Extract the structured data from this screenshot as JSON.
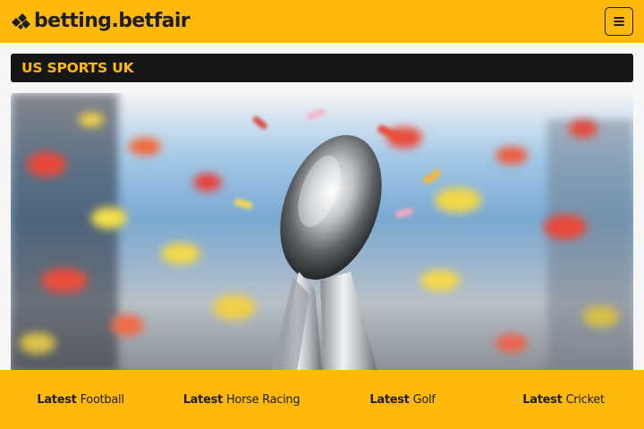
{
  "header": {
    "logo_text": "betting.betfair",
    "menu_icon": "hamburger-menu-icon",
    "brand_color": "#ffb80c",
    "text_color": "#1e1e1e"
  },
  "section": {
    "title": "US SPORTS UK",
    "background": "#161616",
    "title_color": "#ffb80c"
  },
  "hero": {
    "subject": "trophy-image"
  },
  "bottom_nav": {
    "items": [
      {
        "prefix": "Latest",
        "label": "Football"
      },
      {
        "prefix": "Latest",
        "label": "Horse Racing"
      },
      {
        "prefix": "Latest",
        "label": "Golf"
      },
      {
        "prefix": "Latest",
        "label": "Cricket"
      }
    ]
  }
}
